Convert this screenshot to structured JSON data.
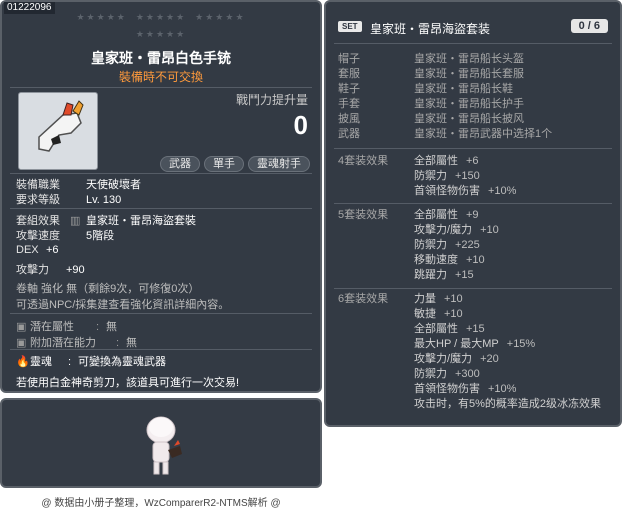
{
  "item": {
    "id": "01222096",
    "name": "皇家班・雷昂白色手铳",
    "untradeable": "裝備時不可交換",
    "power_label": "戰鬥力提升量",
    "power_value": "0",
    "tags": [
      "武器",
      "單手",
      "靈魂射手"
    ],
    "job_label": "裝備職業",
    "job_value": "天使破壞者",
    "level_label": "要求等級",
    "level_value": "Lv. 130",
    "set_label": "套組效果",
    "set_value": "皇家班・雷昂海盜套裝",
    "speed_label": "攻擊速度",
    "speed_value": "5階段",
    "dex_label": "DEX",
    "dex_value": "+6",
    "atk_label": "攻擊力",
    "atk_value": "+90",
    "scroll_info": "卷軸 強化 無（剩餘9次，可修復0次）",
    "npc_info": "可透過NPC/採集建查看強化資訊詳細內容。",
    "potential_label": "潛在屬性",
    "potential_value": "無",
    "addpot_label": "附加潛在能力",
    "addpot_value": "無",
    "soul_label": "靈魂",
    "soul_value": "可變換為靈魂武器",
    "scissors": "若使用白金神奇剪刀，該道具可進行一次交易!"
  },
  "set": {
    "badge": "SET",
    "title": "皇家班・雷昂海盜套装",
    "count": "0 / 6",
    "pieces": [
      {
        "slot": "帽子",
        "name": "皇家班・雷昂船长头盔"
      },
      {
        "slot": "套服",
        "name": "皇家班・雷昂船长套服"
      },
      {
        "slot": "鞋子",
        "name": "皇家班・雷昂船长鞋"
      },
      {
        "slot": "手套",
        "name": "皇家班・雷昂船长护手"
      },
      {
        "slot": "披風",
        "name": "皇家班・雷昂船长披风"
      },
      {
        "slot": "武器",
        "name": "皇家班・雷昂武器中选择1个"
      }
    ],
    "effects": [
      {
        "label": "4套装效果",
        "stats": [
          {
            "n": "全部屬性",
            "v": "+6"
          },
          {
            "n": "防禦力",
            "v": "+150"
          },
          {
            "n": "首領怪物伤害",
            "v": "+10%"
          }
        ]
      },
      {
        "label": "5套装效果",
        "stats": [
          {
            "n": "全部屬性",
            "v": "+9"
          },
          {
            "n": "攻擊力/魔力",
            "v": "+10"
          },
          {
            "n": "防禦力",
            "v": "+225"
          },
          {
            "n": "移動速度",
            "v": "+10"
          },
          {
            "n": "跳躍力",
            "v": "+15"
          }
        ]
      },
      {
        "label": "6套装效果",
        "stats": [
          {
            "n": "力量",
            "v": "+10"
          },
          {
            "n": "敏捷",
            "v": "+10"
          },
          {
            "n": "全部屬性",
            "v": "+15"
          },
          {
            "n": "最大HP / 最大MP",
            "v": "+15%"
          },
          {
            "n": "攻擊力/魔力",
            "v": "+20"
          },
          {
            "n": "防禦力",
            "v": "+300"
          },
          {
            "n": "首領怪物伤害",
            "v": "+10%"
          },
          {
            "n": "攻击时，有5%的概率造成2级冰冻效果",
            "v": ""
          }
        ]
      }
    ]
  },
  "footer": "@ 数据由小册子整理，WzComparerR2-NTMS解析 @",
  "colors": {
    "panel": "#333a44",
    "orange": "#ff9a3c",
    "border": "#5a6068"
  }
}
